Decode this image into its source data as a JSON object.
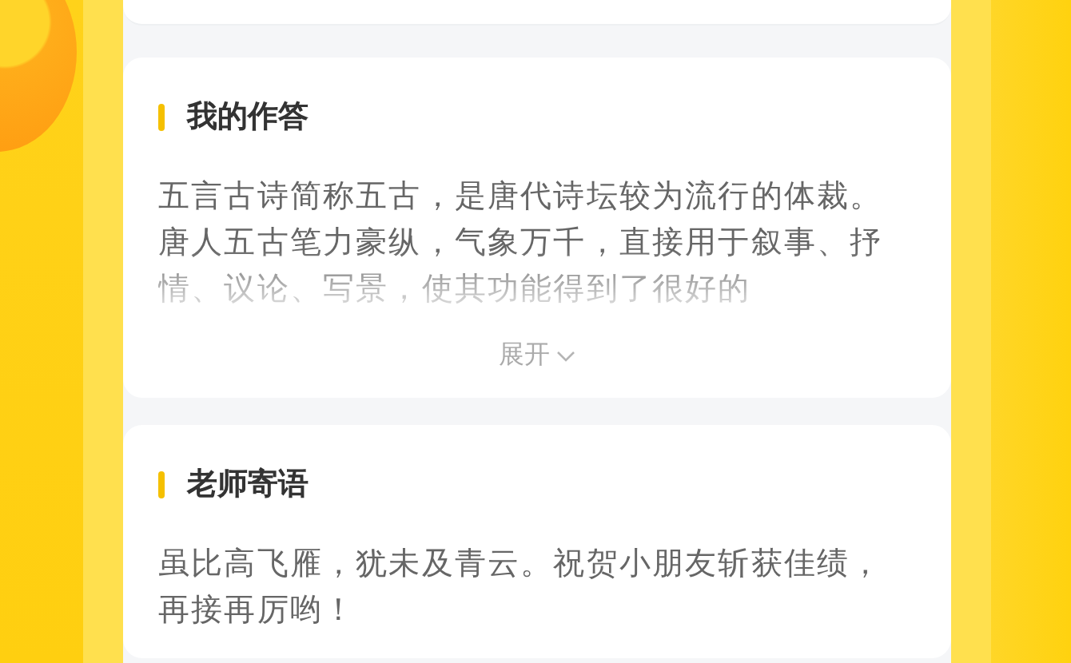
{
  "sections": [
    {
      "title": "我的作答",
      "text": "五言古诗简称五古，是唐代诗坛较为流行的体裁。唐人五古笔力豪纵，气象万千，直接用于叙事、抒情、议论、写景，使其功能得到了很好的",
      "collapsed": true,
      "toggle": "展开"
    },
    {
      "title": "老师寄语",
      "text": "虽比高飞雁，犹未及青云。祝贺小朋友斩获佳绩，再接再厉哟！",
      "collapsed": false
    }
  ]
}
